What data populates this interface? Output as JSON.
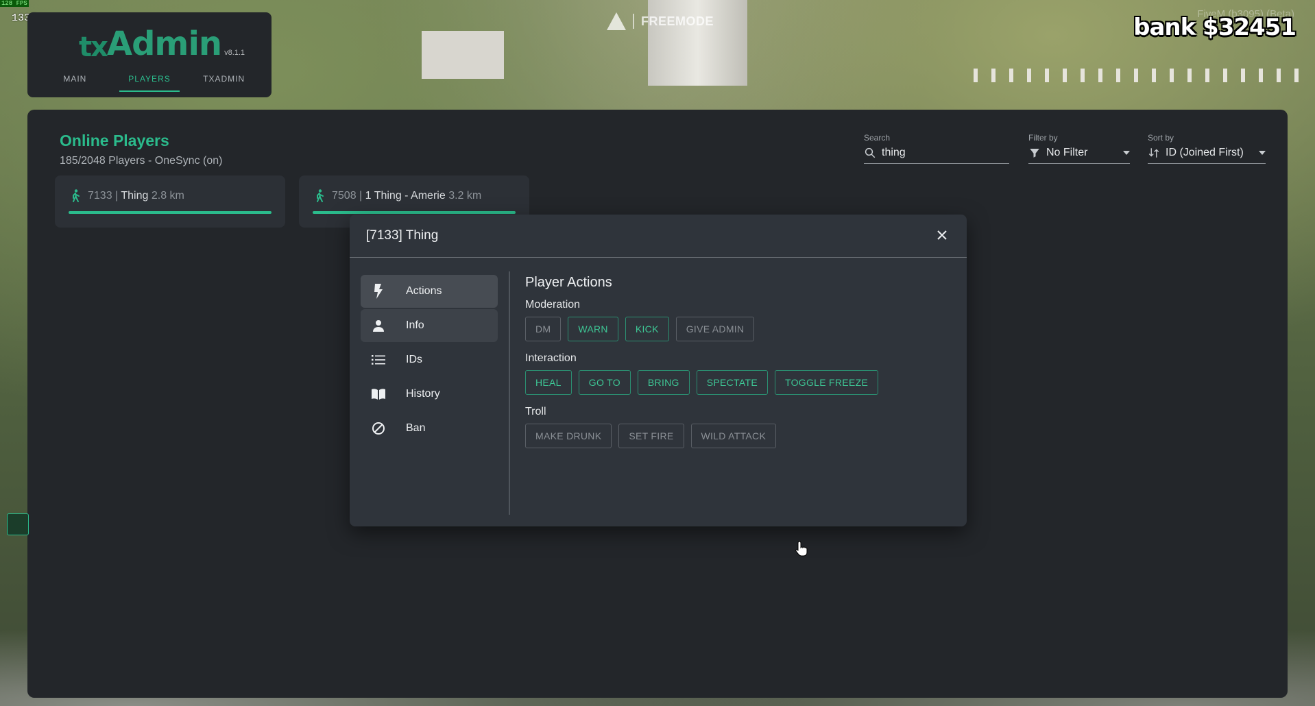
{
  "overlay": {
    "fps": "133fps",
    "fps_small": "128 FPS",
    "freemode": "FREEMODE",
    "build": "FiveM (b3095) (Beta)",
    "bank": "bank $32451"
  },
  "header": {
    "brand_tx": "tx",
    "brand_admin": "Admin",
    "version": "v8.1.1",
    "tabs": [
      "MAIN",
      "PLAYERS",
      "TXADMIN"
    ],
    "active_tab": "PLAYERS"
  },
  "players_page": {
    "title": "Online Players",
    "subtitle": "185/2048 Players - OneSync (on)",
    "search": {
      "label": "Search",
      "value": "thing",
      "icon": "search-icon"
    },
    "filter": {
      "label": "Filter by",
      "value": "No Filter",
      "icon": "filter-icon"
    },
    "sort": {
      "label": "Sort by",
      "value": "ID (Joined First)",
      "icon": "sort-icon"
    },
    "players": [
      {
        "id": "7133",
        "name": "Thing",
        "distance": "2.8 km",
        "health": 1.0,
        "icon": "walking-person-icon"
      },
      {
        "id": "7508",
        "name": "1 Thing - Amerie",
        "distance": "3.2 km",
        "health": 1.0,
        "icon": "walking-person-icon"
      }
    ]
  },
  "modal": {
    "title": "[7133] Thing",
    "sidebar": [
      {
        "label": "Actions",
        "icon": "bolt-icon",
        "state": "active"
      },
      {
        "label": "Info",
        "icon": "person-icon",
        "state": "hover"
      },
      {
        "label": "IDs",
        "icon": "list-icon",
        "state": ""
      },
      {
        "label": "History",
        "icon": "book-icon",
        "state": ""
      },
      {
        "label": "Ban",
        "icon": "ban-icon",
        "state": ""
      }
    ],
    "content_title": "Player Actions",
    "sections": [
      {
        "title": "Moderation",
        "buttons": [
          {
            "label": "DM",
            "style": "grey"
          },
          {
            "label": "WARN",
            "style": "green"
          },
          {
            "label": "KICK",
            "style": "green"
          },
          {
            "label": "GIVE ADMIN",
            "style": "grey"
          }
        ]
      },
      {
        "title": "Interaction",
        "buttons": [
          {
            "label": "HEAL",
            "style": "green"
          },
          {
            "label": "GO TO",
            "style": "green"
          },
          {
            "label": "BRING",
            "style": "green"
          },
          {
            "label": "SPECTATE",
            "style": "green"
          },
          {
            "label": "TOGGLE FREEZE",
            "style": "green"
          }
        ]
      },
      {
        "title": "Troll",
        "buttons": [
          {
            "label": "MAKE DRUNK",
            "style": "grey"
          },
          {
            "label": "SET FIRE",
            "style": "grey"
          },
          {
            "label": "WILD ATTACK",
            "style": "grey"
          }
        ]
      }
    ]
  },
  "colors": {
    "accent": "#2bbb8c",
    "panel": "#23262a",
    "modal": "#2f343b"
  }
}
